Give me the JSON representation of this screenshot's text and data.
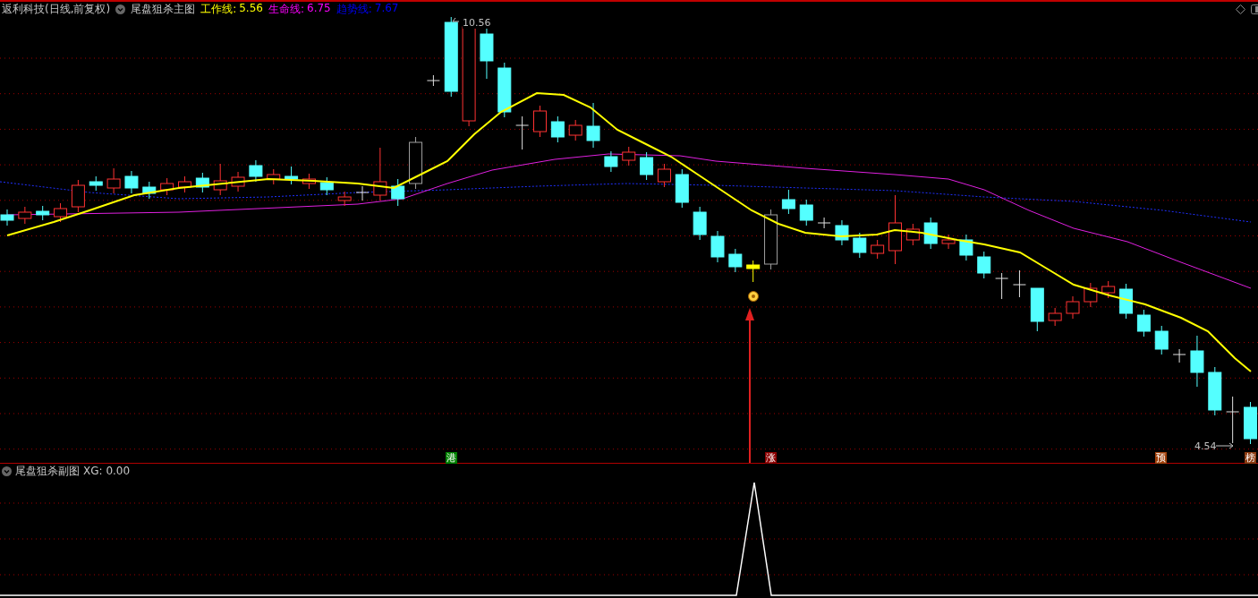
{
  "header": {
    "stock": "返利科技(日线,前复权)",
    "indicator": "尾盘狙杀主图",
    "lines": [
      {
        "kind": "work",
        "label": "工作线:",
        "value": "5.56"
      },
      {
        "kind": "life",
        "label": "生命线:",
        "value": "6.75"
      },
      {
        "kind": "trend",
        "label": "趋势线:",
        "value": "7.67"
      }
    ]
  },
  "main_chart": {
    "high_label": "10.56",
    "low_label": "4.54",
    "markers": [
      {
        "text": "港",
        "color": "#008000"
      },
      {
        "text": "涨",
        "color": "#8b0000"
      },
      {
        "text": "预",
        "color": "#a0400a"
      },
      {
        "text": "榜",
        "color": "#8b3a10"
      }
    ]
  },
  "sub_chart": {
    "title": "尾盘狙杀副图",
    "reading": "XG: 0.00"
  }
}
